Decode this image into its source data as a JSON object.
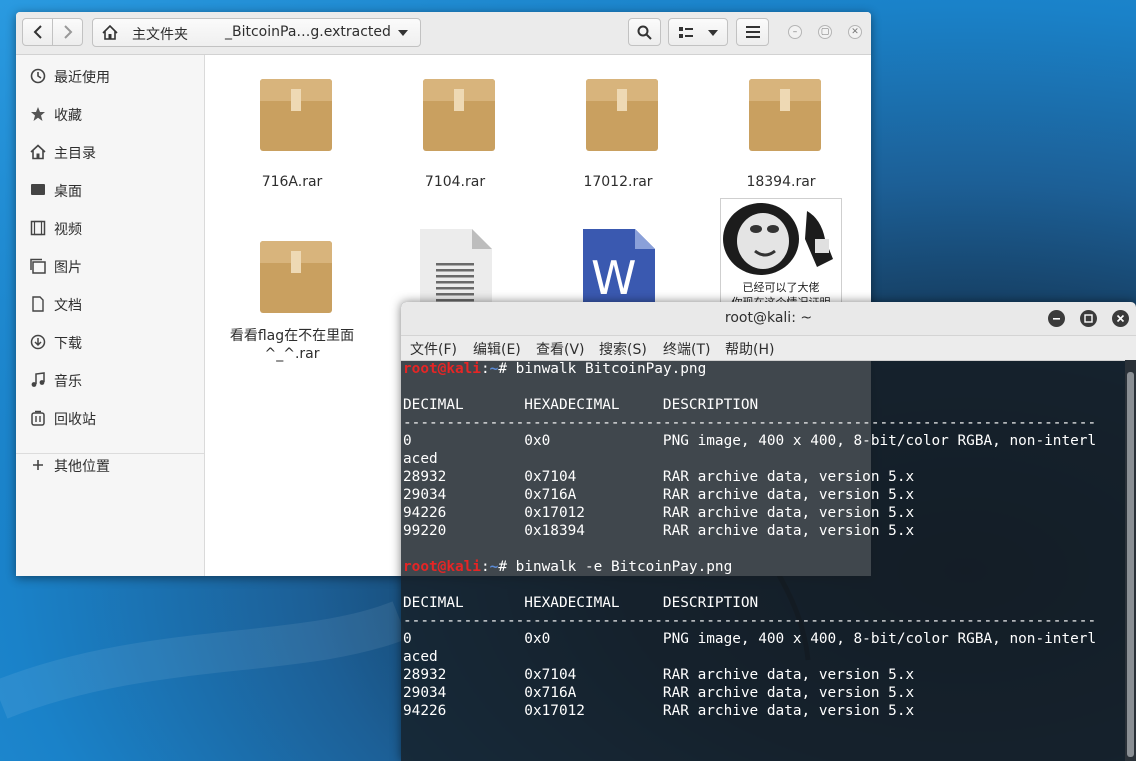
{
  "file_manager": {
    "path": {
      "home_label": "主文件夹",
      "current": "_BitcoinPa…g.extracted"
    },
    "sidebar": [
      {
        "label": "最近使用",
        "icon": "clock-icon"
      },
      {
        "label": "收藏",
        "icon": "star-icon"
      },
      {
        "label": "主目录",
        "icon": "home-icon"
      },
      {
        "label": "桌面",
        "icon": "desktop-icon"
      },
      {
        "label": "视频",
        "icon": "film-icon"
      },
      {
        "label": "图片",
        "icon": "image-icon"
      },
      {
        "label": "文档",
        "icon": "document-icon"
      },
      {
        "label": "下载",
        "icon": "download-icon"
      },
      {
        "label": "音乐",
        "icon": "music-icon"
      },
      {
        "label": "回收站",
        "icon": "trash-icon"
      },
      {
        "label": "其他位置",
        "icon": "plus-icon"
      }
    ],
    "files": [
      {
        "name": "716A.rar",
        "kind": "archive"
      },
      {
        "name": "7104.rar",
        "kind": "archive"
      },
      {
        "name": "17012.rar",
        "kind": "archive"
      },
      {
        "name": "18394.rar",
        "kind": "archive"
      },
      {
        "name": "看看flag在不在里面^_^.rar",
        "name_line1": "看看flag在不在里面",
        "name_line2": "^_^.rar",
        "kind": "archive"
      },
      {
        "name": "",
        "kind": "text-document"
      },
      {
        "name": "",
        "kind": "word-document"
      },
      {
        "name": "",
        "kind": "image",
        "thumbnail_caption_1": "已经可以了大佬",
        "thumbnail_caption_2": "你现在这个情况证明"
      }
    ]
  },
  "terminal": {
    "title": "root@kali: ~",
    "menu": [
      "文件(F)",
      "编辑(E)",
      "查看(V)",
      "搜索(S)",
      "终端(T)",
      "帮助(H)"
    ],
    "prompt": {
      "user": "root@kali",
      "sep": ":",
      "path": "~",
      "symbol": "# "
    },
    "cmd1": "binwalk BitcoinPay.png",
    "cmd2": "binwalk -e BitcoinPay.png",
    "header": "DECIMAL       HEXADECIMAL     DESCRIPTION",
    "rule": "--------------------------------------------------------------------------------",
    "out1": [
      "0             0x0             PNG image, 400 x 400, 8-bit/color RGBA, non-interl",
      "aced",
      "28932         0x7104          RAR archive data, version 5.x",
      "29034         0x716A          RAR archive data, version 5.x",
      "94226         0x17012         RAR archive data, version 5.x",
      "99220         0x18394         RAR archive data, version 5.x"
    ],
    "out2": [
      "0             0x0             PNG image, 400 x 400, 8-bit/color RGBA, non-interl",
      "aced",
      "28932         0x7104          RAR archive data, version 5.x",
      "29034         0x716A          RAR archive data, version 5.x",
      "94226         0x17012         RAR archive data, version 5.x"
    ]
  }
}
